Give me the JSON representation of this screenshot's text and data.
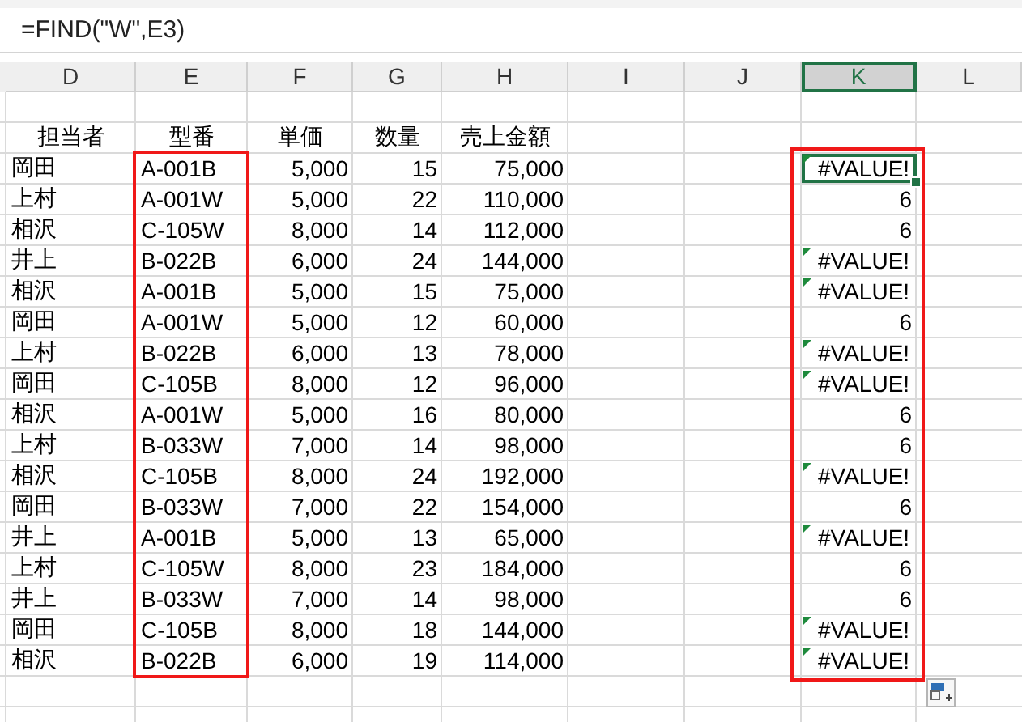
{
  "formula_bar": {
    "formula": "=FIND(\"W\",E3)"
  },
  "columns": [
    {
      "label": "D",
      "selected": false
    },
    {
      "label": "E",
      "selected": false
    },
    {
      "label": "F",
      "selected": false
    },
    {
      "label": "G",
      "selected": false
    },
    {
      "label": "H",
      "selected": false
    },
    {
      "label": "I",
      "selected": false
    },
    {
      "label": "J",
      "selected": false
    },
    {
      "label": "K",
      "selected": true
    },
    {
      "label": "L",
      "selected": false
    }
  ],
  "table_headers": [
    "担当者",
    "型番",
    "単価",
    "数量",
    "売上金額"
  ],
  "rows": [
    {
      "person": "岡田",
      "model": "A-001B",
      "price": "5,000",
      "quantity": "15",
      "amount": "75,000",
      "result": "#VALUE!",
      "kind": "error",
      "selected": true
    },
    {
      "person": "上村",
      "model": "A-001W",
      "price": "5,000",
      "quantity": "22",
      "amount": "110,000",
      "result": "6",
      "kind": "number",
      "selected": false
    },
    {
      "person": "相沢",
      "model": "C-105W",
      "price": "8,000",
      "quantity": "14",
      "amount": "112,000",
      "result": "6",
      "kind": "number",
      "selected": false
    },
    {
      "person": "井上",
      "model": "B-022B",
      "price": "6,000",
      "quantity": "24",
      "amount": "144,000",
      "result": "#VALUE!",
      "kind": "error",
      "selected": false
    },
    {
      "person": "相沢",
      "model": "A-001B",
      "price": "5,000",
      "quantity": "15",
      "amount": "75,000",
      "result": "#VALUE!",
      "kind": "error",
      "selected": false
    },
    {
      "person": "岡田",
      "model": "A-001W",
      "price": "5,000",
      "quantity": "12",
      "amount": "60,000",
      "result": "6",
      "kind": "number",
      "selected": false
    },
    {
      "person": "上村",
      "model": "B-022B",
      "price": "6,000",
      "quantity": "13",
      "amount": "78,000",
      "result": "#VALUE!",
      "kind": "error",
      "selected": false
    },
    {
      "person": "岡田",
      "model": "C-105B",
      "price": "8,000",
      "quantity": "12",
      "amount": "96,000",
      "result": "#VALUE!",
      "kind": "error",
      "selected": false
    },
    {
      "person": "相沢",
      "model": "A-001W",
      "price": "5,000",
      "quantity": "16",
      "amount": "80,000",
      "result": "6",
      "kind": "number",
      "selected": false
    },
    {
      "person": "上村",
      "model": "B-033W",
      "price": "7,000",
      "quantity": "14",
      "amount": "98,000",
      "result": "6",
      "kind": "number",
      "selected": false
    },
    {
      "person": "相沢",
      "model": "C-105B",
      "price": "8,000",
      "quantity": "24",
      "amount": "192,000",
      "result": "#VALUE!",
      "kind": "error",
      "selected": false
    },
    {
      "person": "岡田",
      "model": "B-033W",
      "price": "7,000",
      "quantity": "22",
      "amount": "154,000",
      "result": "6",
      "kind": "number",
      "selected": false
    },
    {
      "person": "井上",
      "model": "A-001B",
      "price": "5,000",
      "quantity": "13",
      "amount": "65,000",
      "result": "#VALUE!",
      "kind": "error",
      "selected": false
    },
    {
      "person": "上村",
      "model": "C-105W",
      "price": "8,000",
      "quantity": "23",
      "amount": "184,000",
      "result": "6",
      "kind": "number",
      "selected": false
    },
    {
      "person": "井上",
      "model": "B-033W",
      "price": "7,000",
      "quantity": "14",
      "amount": "98,000",
      "result": "6",
      "kind": "number",
      "selected": false
    },
    {
      "person": "岡田",
      "model": "C-105B",
      "price": "8,000",
      "quantity": "18",
      "amount": "144,000",
      "result": "#VALUE!",
      "kind": "error",
      "selected": false
    },
    {
      "person": "相沢",
      "model": "B-022B",
      "price": "6,000",
      "quantity": "19",
      "amount": "114,000",
      "result": "#VALUE!",
      "kind": "error",
      "selected": false
    }
  ]
}
